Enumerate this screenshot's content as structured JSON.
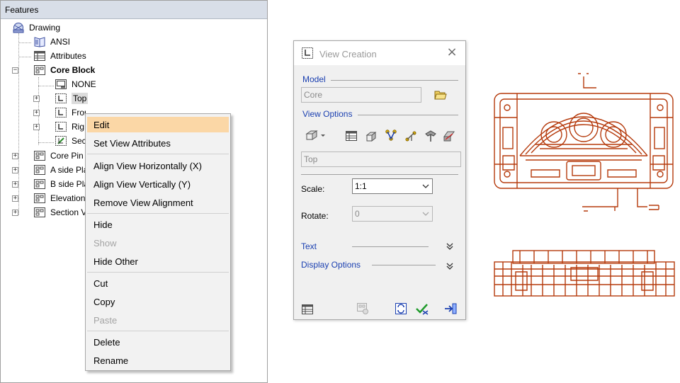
{
  "features": {
    "header": "Features",
    "items": [
      {
        "label": "Drawing",
        "icon": "drawing-icon"
      },
      {
        "label": "ANSI",
        "icon": "book-icon"
      },
      {
        "label": "Attributes",
        "icon": "attributes-table-icon"
      },
      {
        "label": "Core Block",
        "icon": "sheet-icon",
        "expander": "−"
      },
      {
        "label": "NONE",
        "icon": "border-icon"
      },
      {
        "label": "Top",
        "icon": "view-icon",
        "expander": "+"
      },
      {
        "label": "Front",
        "icon": "view-icon",
        "expander": "+"
      },
      {
        "label": "Rig",
        "icon": "view-icon",
        "expander": "+"
      },
      {
        "label": "Sec",
        "icon": "section-view-icon"
      },
      {
        "label": "Core Pin",
        "icon": "sheet-icon",
        "expander": "+"
      },
      {
        "label": "A side Pla",
        "icon": "sheet-icon",
        "expander": "+"
      },
      {
        "label": "B side Pla",
        "icon": "sheet-icon",
        "expander": "+"
      },
      {
        "label": "Elevation",
        "icon": "sheet-icon",
        "expander": "+"
      },
      {
        "label": "Section V",
        "icon": "sheet-icon",
        "expander": "+"
      }
    ]
  },
  "context_menu": {
    "items": [
      {
        "label": "Edit",
        "highlighted": true
      },
      {
        "label": "Set View Attributes"
      },
      {
        "label": "Align View Horizontally (X)"
      },
      {
        "label": "Align View Vertically (Y)"
      },
      {
        "label": "Remove View Alignment"
      },
      {
        "label": "Hide"
      },
      {
        "label": "Show",
        "disabled": true
      },
      {
        "label": "Hide Other"
      },
      {
        "label": "Cut"
      },
      {
        "label": "Copy"
      },
      {
        "label": "Paste",
        "disabled": true
      },
      {
        "label": "Delete"
      },
      {
        "label": "Rename"
      }
    ]
  },
  "view_creation": {
    "title": "View Creation",
    "close_icon": "×",
    "model_label": "Model",
    "model_value": "Core",
    "view_options_label": "View Options",
    "view_name": "Top",
    "scale_label": "Scale:",
    "scale_value": "1:1",
    "rotate_label": "Rotate:",
    "rotate_value": "0",
    "text_label": "Text",
    "display_options_label": "Display Options"
  },
  "colors": {
    "drawing": "#b53a0c",
    "accent_blue": "#1a3fb0",
    "menu_highlight": "#fbd7a6",
    "header_bg": "#d8dee8"
  }
}
